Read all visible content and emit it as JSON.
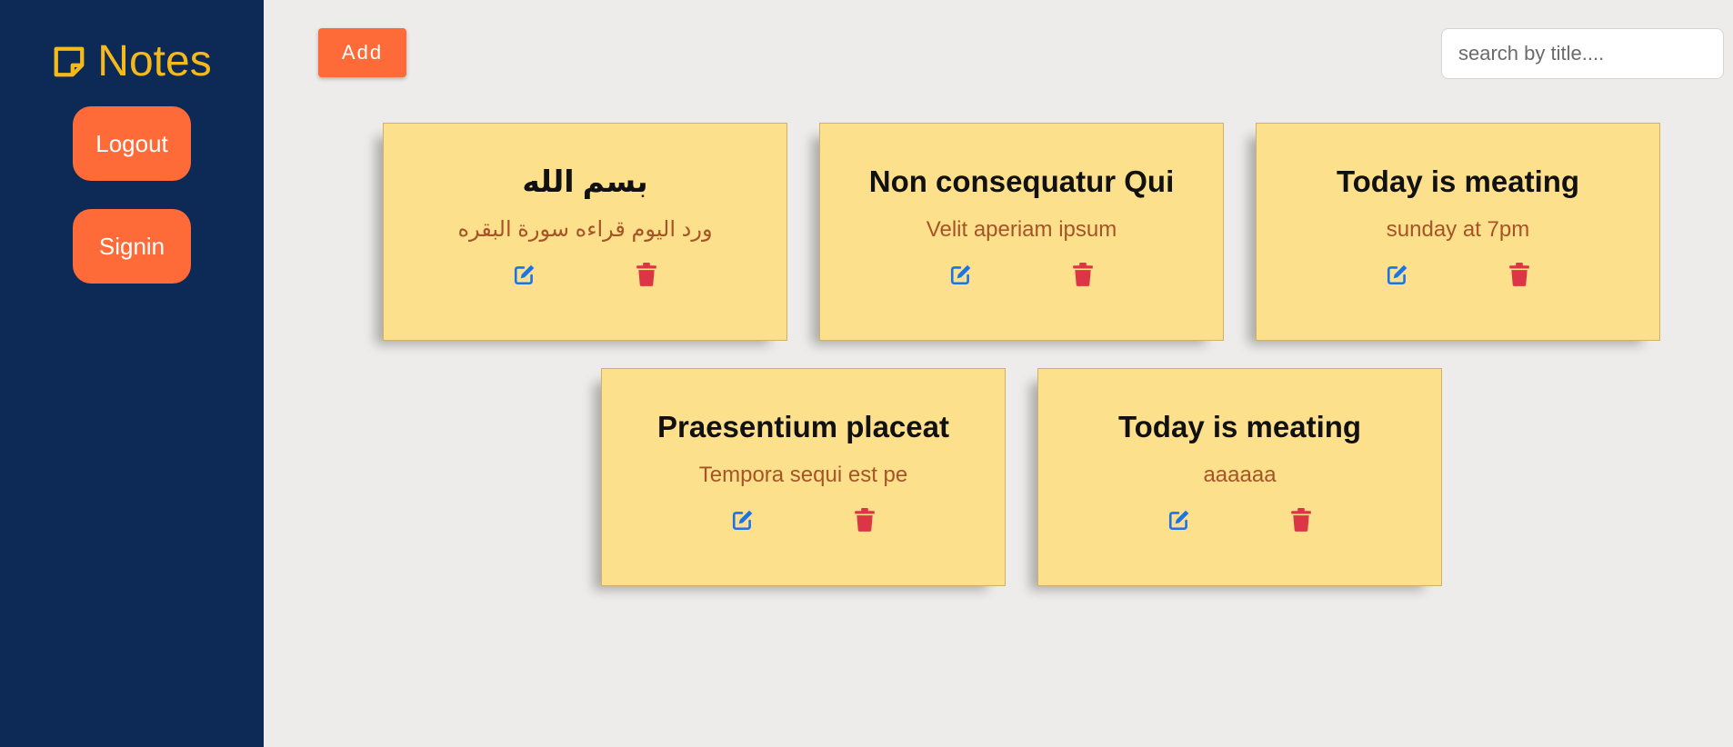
{
  "app": {
    "title": "Notes",
    "brand_color": "#f5b91b",
    "sidebar_color": "#0d2a57",
    "accent_color": "#fe6a38",
    "note_color": "#fde08b",
    "edit_icon_color": "#1a73e8",
    "delete_icon_color": "#dc3545"
  },
  "sidebar": {
    "logout_label": "Logout",
    "signin_label": "Signin"
  },
  "toolbar": {
    "add_label": "Add",
    "search_placeholder": "search by title....",
    "search_value": ""
  },
  "notes": [
    {
      "title": "بسم الله",
      "body": "ورد اليوم قراءه سورة البقره"
    },
    {
      "title": "Non consequatur Qui",
      "body": "Velit aperiam ipsum"
    },
    {
      "title": "Today is meating",
      "body": "sunday at 7pm"
    },
    {
      "title": "Praesentium placeat",
      "body": "Tempora sequi est pe"
    },
    {
      "title": "Today is meating",
      "body": "aaaaaa"
    }
  ]
}
